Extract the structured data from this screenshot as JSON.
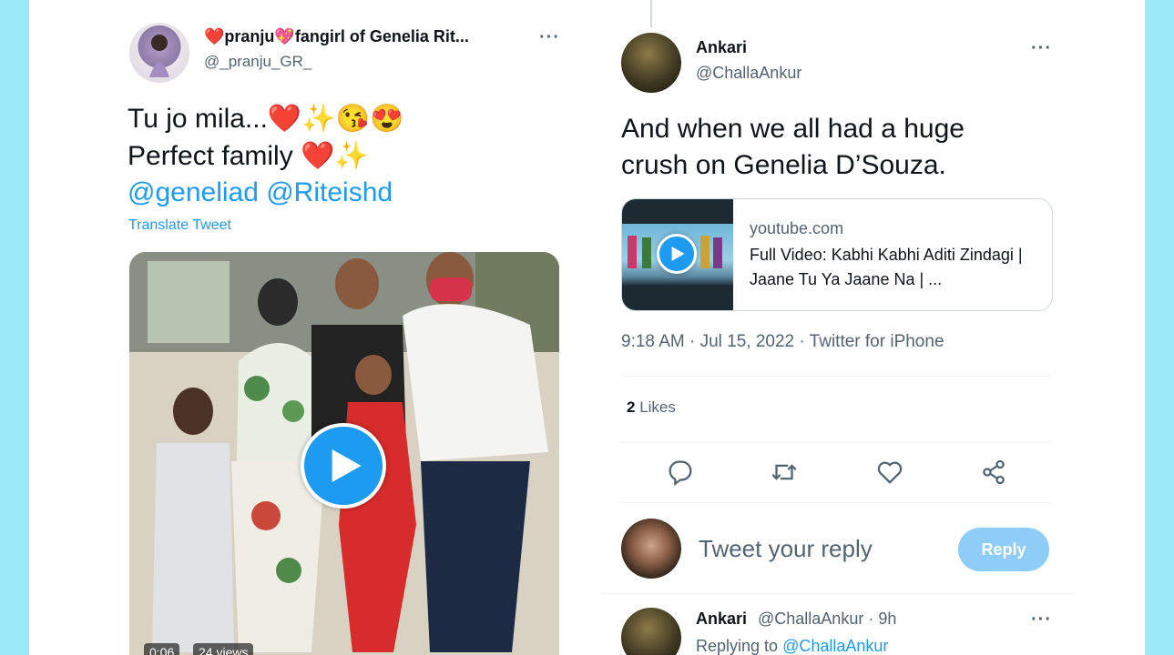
{
  "left_tweet": {
    "display_name": "❤️pranju💖fangirl of Genelia Rit...",
    "handle": "@_pranju_GR_",
    "more": "···",
    "line1": "Tu jo mila...❤️✨😘😍",
    "line2": "Perfect family ❤️✨",
    "mentions": "@geneliad @Riteishd",
    "translate": "Translate Tweet",
    "video_time": "0:06",
    "video_views": "24 views"
  },
  "right_tweet": {
    "display_name": "Ankari",
    "handle": "@ChallaAnkur",
    "more": "···",
    "text_line1": "And when we all had a huge",
    "text_line2": "crush on Genelia D’Souza.",
    "card": {
      "domain": "youtube.com",
      "title": "Full Video: Kabhi Kabhi Aditi Zindagi | Jaane Tu Ya Jaane Na | ..."
    },
    "meta": "9:18 AM · Jul 15, 2022 · Twitter for iPhone",
    "likes_count": "2",
    "likes_label": "Likes",
    "actions": [
      "reply-icon",
      "retweet-icon",
      "like-icon",
      "share-icon"
    ]
  },
  "compose": {
    "placeholder": "Tweet your reply",
    "button": "Reply"
  },
  "reply_tweet": {
    "display_name": "Ankari",
    "handle_time": "@ChallaAnkur · 9h",
    "replying_prefix": "Replying to",
    "replying_handle": "@ChallaAnkur",
    "more": "···"
  },
  "colors": {
    "accent": "#1d9bf0",
    "background": "#9beaf9",
    "reply_button": "#8ecdf7"
  }
}
